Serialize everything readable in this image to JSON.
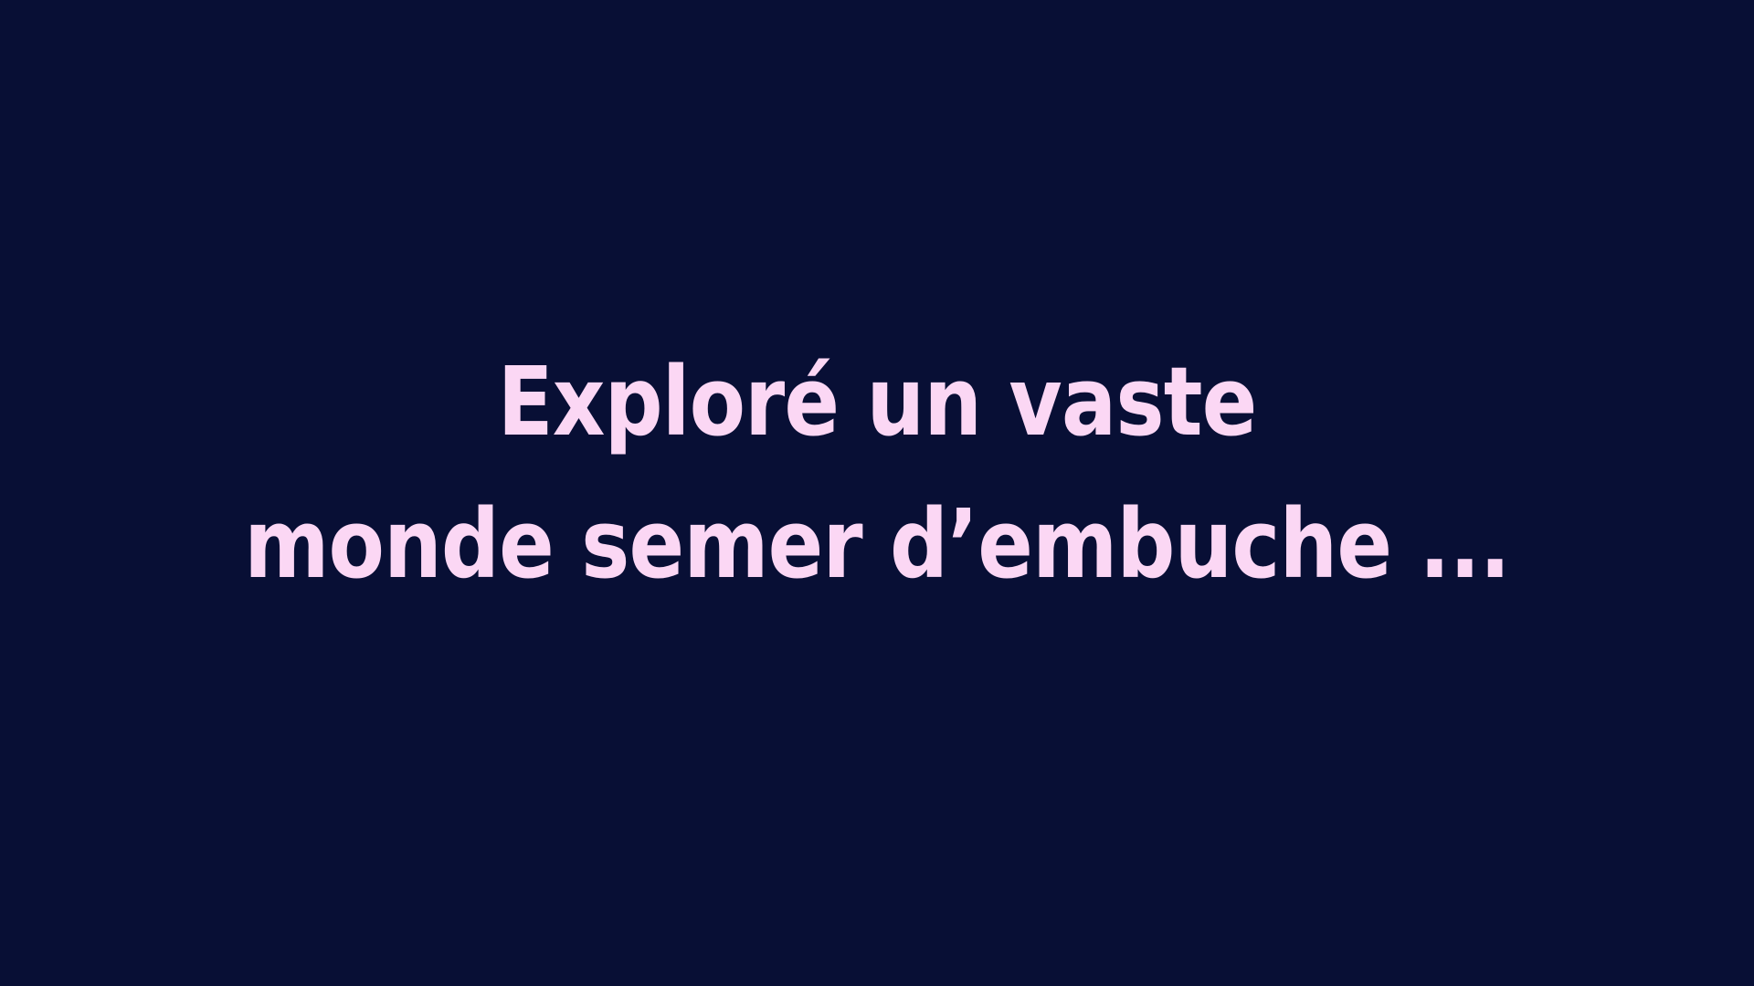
{
  "title": {
    "line1": "Exploré un vaste",
    "line2": "monde semer d’embuche ..."
  },
  "colors": {
    "background": "#080F35",
    "text": "#FBD7F4"
  }
}
